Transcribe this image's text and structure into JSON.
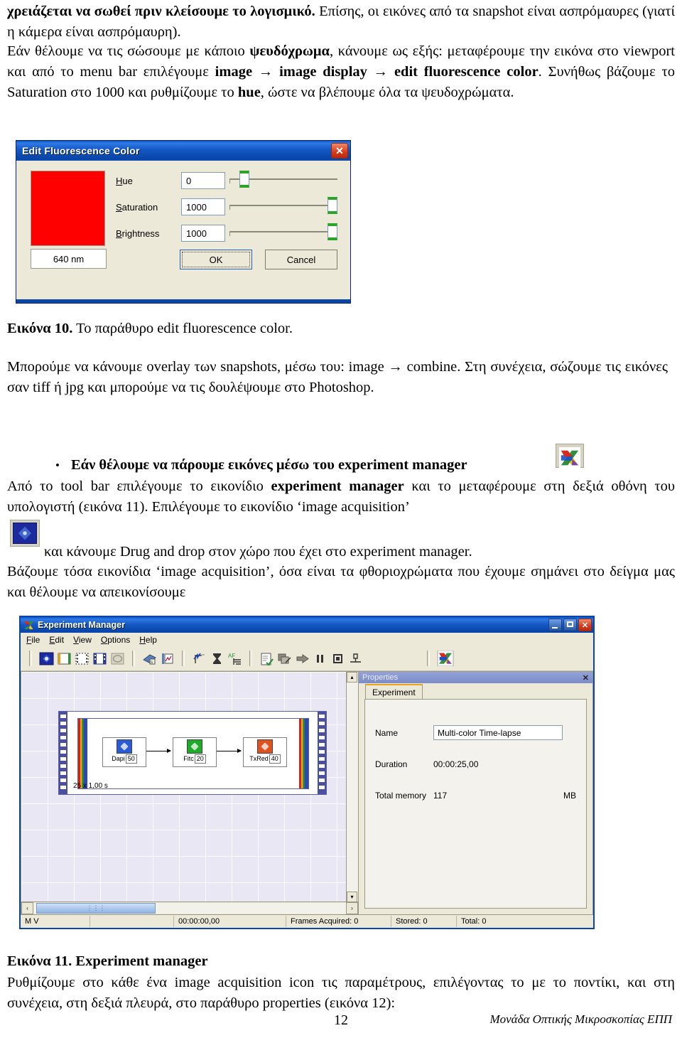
{
  "document": {
    "page_number": "12",
    "footer_note": "Μονάδα Οπτικής Μικροσκοπίας ΕΠΠ"
  },
  "text": {
    "p1_bold": "χρειάζεται να σωθεί πριν κλείσουμε το λογισμικό.",
    "p1_rest": " Επίσης, οι εικόνες από τα snapshot είναι ασπρόμαυρες (γιατί η κάμερα είναι ασπρόμαυρη).",
    "p2_a": "Εάν θέλουμε να τις σώσουμε με κάποιο ",
    "p2_b1": "ψευδόχρωμα",
    "p2_c": ", κάνουμε ως εξής: μεταφέρουμε την εικόνα στο viewport και από το menu bar επιλέγουμε ",
    "p2_b2": "image → image display → edit fluorescence color",
    "p2_d": ". Συνήθως βάζουμε το Saturation στο 1000 και ρυθμίζουμε το ",
    "p2_b3": "hue",
    "p2_e": ", ώστε να βλέπουμε όλα τα ψευδοχρώματα.",
    "cap10_bold": "Εικόνα 10.",
    "cap10_rest": " Το παράθυρο edit fluorescence color.",
    "p3": "Μπορούμε να κάνουμε overlay των snapshots, μέσω του: image → combine. Στη συνέχεια, σώζουμε τις εικόνες σαν tiff ή jpg και μπορούμε  να τις δουλέψουμε στο Photoshop.",
    "bullet_b": "Εάν θέλουμε να πάρουμε εικόνες μέσω του experiment manager",
    "p4_a": "Από το tool bar επιλέγουμε το εικονίδιο ",
    "p4_b": "experiment manager",
    "p4_c": " και το μεταφέρουμε στη δεξιά οθόνη του υπολογιστή (εικόνα 11). Επιλέγουμε το εικονίδιο ‘image acquisition’",
    "p5": " και κάνουμε Drug and drop στον χώρο που έχει στο experiment manager.",
    "p6": "Βάζουμε τόσα εικονίδια ‘image acquisition’, όσα είναι τα φθοριοχρώματα που έχουμε σημάνει στο δείγμα μας και θέλουμε να απεικονίσουμε",
    "cap11_bold": "Εικόνα 11.",
    "cap11_rest": " Experiment manager",
    "p7": "Ρυθμίζουμε στο κάθε ένα image acquisition icon  τις παραμέτρους, επιλέγοντας το με το ποντίκι, και στη συνέχεια, στη δεξιά πλευρά, στο παράθυρο properties (εικόνα 12):"
  },
  "edit_fluorescence_dialog": {
    "title": "Edit Fluorescence Color",
    "close_glyph": "✕",
    "swatch_color": "#fe0000",
    "wavelength": "640 nm",
    "fields": [
      {
        "label_underline": "H",
        "label_rest": "ue",
        "value": "0",
        "slider_percent": 13
      },
      {
        "label_underline": "S",
        "label_rest": "aturation",
        "value": "1000",
        "slider_percent": 100
      },
      {
        "label_underline": "B",
        "label_rest": "rightness",
        "value": "1000",
        "slider_percent": 100
      }
    ],
    "ok_label": "OK",
    "cancel_label": "Cancel"
  },
  "experiment_manager": {
    "title": "Experiment Manager",
    "window_buttons": {
      "minimize": "minimize-button",
      "maximize": "maximize-button",
      "close": "✕"
    },
    "menu": [
      {
        "u": "F",
        "rest": "ile"
      },
      {
        "u": "E",
        "rest": "dit"
      },
      {
        "u": "V",
        "rest": "iew"
      },
      {
        "u": "O",
        "rest": "ptions"
      },
      {
        "u": "H",
        "rest": "elp"
      }
    ],
    "toolbar_groups": [
      [
        "image-acquisition-icon",
        "single-capture-icon",
        "film-strip-left-icon",
        "film-strip-right-icon",
        "snapshot-disabled-icon"
      ],
      [
        "load-experiment-icon",
        "save-experiment-icon"
      ],
      [
        "z-stack-icon",
        "wait-timer-icon",
        "autofocus-icon"
      ],
      [
        "edit-protocol-icon",
        "duplicate-step-icon",
        "run-icon",
        "pause-icon",
        "stop-icon",
        "end-icon"
      ],
      [
        "experiment-manager-icon"
      ]
    ],
    "canvas": {
      "loop_label": "25 x 1,00 s",
      "nodes": [
        {
          "name": "Dapi",
          "value": "50",
          "color": "#2a5bd7"
        },
        {
          "name": "Fitc",
          "value": "20",
          "color": "#1faa2a"
        },
        {
          "name": "TxRed",
          "value": "40",
          "color": "#e0511c"
        }
      ]
    },
    "properties": {
      "panel_title": "Properties",
      "close_glyph": "✕",
      "tab": "Experiment",
      "rows": [
        {
          "label": "Name",
          "value": "Multi-color Time-lapse",
          "unit": "",
          "type": "input"
        },
        {
          "label": "Duration",
          "value": "00:00:25,00",
          "unit": "",
          "type": "text"
        },
        {
          "label": "Total memory",
          "value": "117",
          "unit": "MB",
          "type": "text"
        }
      ]
    },
    "scrollbar": {
      "left_glyph": "‹",
      "right_glyph": "›",
      "thumb_glyph": "⋮⋮⋮",
      "up_glyph": "▴",
      "down_glyph": "▾"
    },
    "status": [
      "M     V",
      "",
      "00:00:00,00",
      "Frames Acquired: 0",
      "Stored: 0",
      "Total: 0"
    ]
  }
}
